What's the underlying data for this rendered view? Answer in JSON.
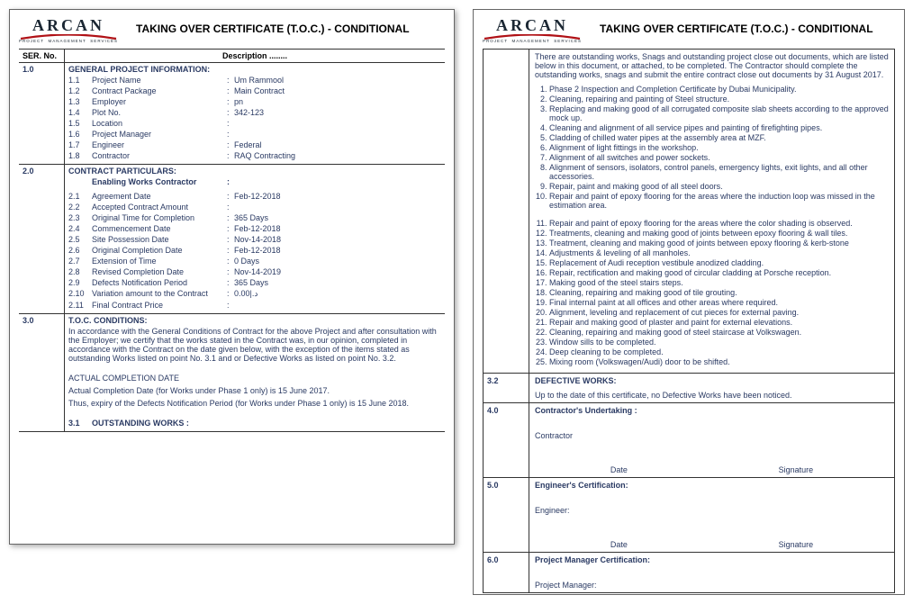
{
  "logo": {
    "name": "ARCAN",
    "tagline": "PROJECT   MANAGEMENT   SERVICES"
  },
  "doc_title": "TAKING OVER CERTIFICATE  (T.O.C.) - CONDITIONAL",
  "table_head": {
    "ser": "SER. No.",
    "desc": "Description ........"
  },
  "s1": {
    "ser": "1.0",
    "title": "GENERAL PROJECT INFORMATION:",
    "rows": [
      {
        "n": "1.1",
        "label": "Project Name",
        "val": "Um Rammool"
      },
      {
        "n": "1.2",
        "label": "Contract Package",
        "val": "Main Contract"
      },
      {
        "n": "1.3",
        "label": "Employer",
        "val": "pn"
      },
      {
        "n": "1.4",
        "label": "Plot No.",
        "val": "342-123"
      },
      {
        "n": "1.5",
        "label": "Location",
        "val": ""
      },
      {
        "n": "1.6",
        "label": "Project Manager",
        "val": ""
      },
      {
        "n": "1.7",
        "label": "Engineer",
        "val": "Federal"
      },
      {
        "n": "1.8",
        "label": "Contractor",
        "val": "RAQ Contracting"
      }
    ]
  },
  "s2": {
    "ser": "2.0",
    "title": "CONTRACT PARTICULARS:",
    "sub_bold": "Enabling Works Contractor",
    "rows": [
      {
        "n": "2.1",
        "label": "Agreement Date",
        "val": "Feb-12-2018"
      },
      {
        "n": "2.2",
        "label": "Accepted Contract Amount",
        "val": ""
      },
      {
        "n": "2.3",
        "label": "Original Time for Completion",
        "val": "365 Days"
      },
      {
        "n": "2.4",
        "label": "Commencement Date",
        "val": "Feb-12-2018"
      },
      {
        "n": "2.5",
        "label": "Site Possession Date",
        "val": "Nov-14-2018"
      },
      {
        "n": "2.6",
        "label": "Original Completion Date",
        "val": "Feb-12-2018"
      },
      {
        "n": "2.7",
        "label": "Extension of Time",
        "val": "0 Days"
      },
      {
        "n": "2.8",
        "label": "Revised Completion Date",
        "val": "Nov-14-2019"
      },
      {
        "n": "2.9",
        "label": "Defects Notification Period",
        "val": "365 Days"
      },
      {
        "n": "2.10",
        "label": "Variation amount to the Contract",
        "val": "0.00|.د"
      },
      {
        "n": "2.11",
        "label": "Final Contract Price",
        "val": ""
      }
    ]
  },
  "s3": {
    "ser": "3.0",
    "title": "T.O.C. CONDITIONS:",
    "para": "In accordance with the General Conditions of Contract for the above Project and after consultation with the Employer; we certify that the works stated in the Contract was, in our opinion, completed in accordance with the Contract on the date given below, with the exception of the items stated as outstanding Works listed on point No. 3.1 and or Defective Works as listed on point No. 3.2.",
    "acd_title": "ACTUAL COMPLETION DATE",
    "acd_line1": "Actual Completion Date (for Works under Phase 1 only) is 15 June 2017.",
    "acd_line2": "Thus, expiry of the Defects Notification Period (for Works under Phase 1 only) is 15 June 2018.",
    "s31_ser": "3.1",
    "s31_title": "OUTSTANDING WORKS :"
  },
  "p2": {
    "intro": "There are outstanding works, Snags and outstanding project close out documents, which are listed below in this document, or attached, to be completed. The Contractor should complete the outstanding works, snags and submit the entire contract close out documents by 31 August 2017.",
    "works": [
      "Phase 2 Inspection and Completion Certificate by Dubai Municipality.",
      "Cleaning, repairing and painting of Steel structure.",
      "Replacing and making good of all corrugated composite slab sheets according to the approved mock up.",
      "Cleaning and alignment of all service pipes and painting of firefighting pipes.",
      "Cladding of chilled water pipes at the assembly area at MZF.",
      "Alignment of light fittings in the workshop.",
      "Alignment of all switches and power sockets.",
      "Alignment of sensors, isolators, control panels, emergency lights, exit lights, and all other accessories.",
      "Repair, paint and making good of all steel doors.",
      "Repair and paint of epoxy flooring for the areas where the induction loop was missed in the estimation area.",
      "Repair and paint of epoxy flooring for the areas where the color shading is observed.",
      "Treatments, cleaning and making good of joints between epoxy flooring & wall tiles.",
      "Treatment, cleaning and making good of joints between epoxy flooring & kerb-stone",
      "Adjustments & leveling of all manholes.",
      "Replacement of Audi reception vestibule anodized cladding.",
      "Repair, rectification and making good of circular cladding at Porsche reception.",
      "Making good of the steel stairs steps.",
      "Cleaning, repairing and making good of tile grouting.",
      "Final internal paint at all offices and other areas where required.",
      "Alignment, leveling and replacement of cut pieces for external paving.",
      "Repair and making good of plaster and paint for external elevations.",
      "Cleaning, repairing and making good of steel staircase at Volkswagen.",
      "Window sills to be completed.",
      "Deep cleaning to be completed.",
      "Mixing room (Volkswagen/Audi) door to be shifted."
    ],
    "s32_ser": "3.2",
    "s32_title": "DEFECTIVE WORKS:",
    "s32_text": "Up to the date of this certificate, no Defective Works have been noticed.",
    "s40_ser": "4.0",
    "s40_title": "Contractor's Undertaking :",
    "s40_role": "Contractor",
    "date": "Date",
    "signature": "Signature",
    "s50_ser": "5.0",
    "s50_title": "Engineer's Certification:",
    "s50_role": "Engineer:",
    "s60_ser": "6.0",
    "s60_title": "Project Manager Certification:",
    "s60_role": "Project Manager:"
  }
}
